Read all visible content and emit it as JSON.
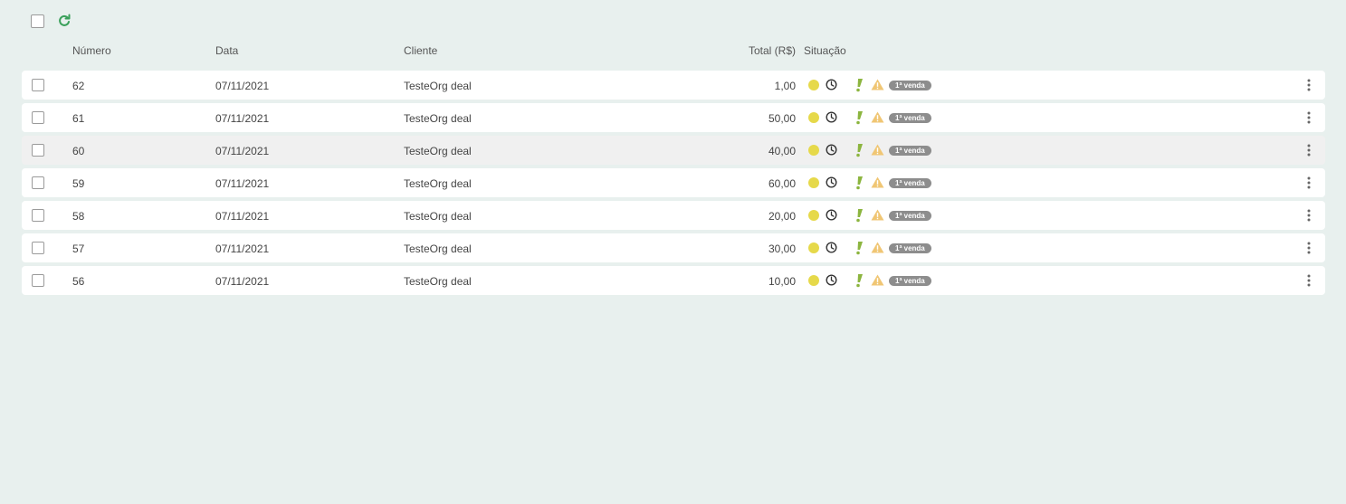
{
  "toolbar": {
    "select_all": false
  },
  "columns": {
    "numero": "Número",
    "data": "Data",
    "cliente": "Cliente",
    "total": "Total (R$)",
    "situacao": "Situação"
  },
  "colors": {
    "status_dot": "#e6d94a",
    "accent_green": "#3aa05a",
    "exclaim": "#8cb53f",
    "warning": "#f0c674",
    "badge": "#8d8d8d"
  },
  "rows": [
    {
      "numero": "62",
      "data": "07/11/2021",
      "cliente": "TesteOrg deal",
      "total": "1,00",
      "badge": "1ª venda"
    },
    {
      "numero": "61",
      "data": "07/11/2021",
      "cliente": "TesteOrg deal",
      "total": "50,00",
      "badge": "1ª venda"
    },
    {
      "numero": "60",
      "data": "07/11/2021",
      "cliente": "TesteOrg deal",
      "total": "40,00",
      "badge": "1ª venda"
    },
    {
      "numero": "59",
      "data": "07/11/2021",
      "cliente": "TesteOrg deal",
      "total": "60,00",
      "badge": "1ª venda"
    },
    {
      "numero": "58",
      "data": "07/11/2021",
      "cliente": "TesteOrg deal",
      "total": "20,00",
      "badge": "1ª venda"
    },
    {
      "numero": "57",
      "data": "07/11/2021",
      "cliente": "TesteOrg deal",
      "total": "30,00",
      "badge": "1ª venda"
    },
    {
      "numero": "56",
      "data": "07/11/2021",
      "cliente": "TesteOrg deal",
      "total": "10,00",
      "badge": "1ª venda"
    }
  ]
}
